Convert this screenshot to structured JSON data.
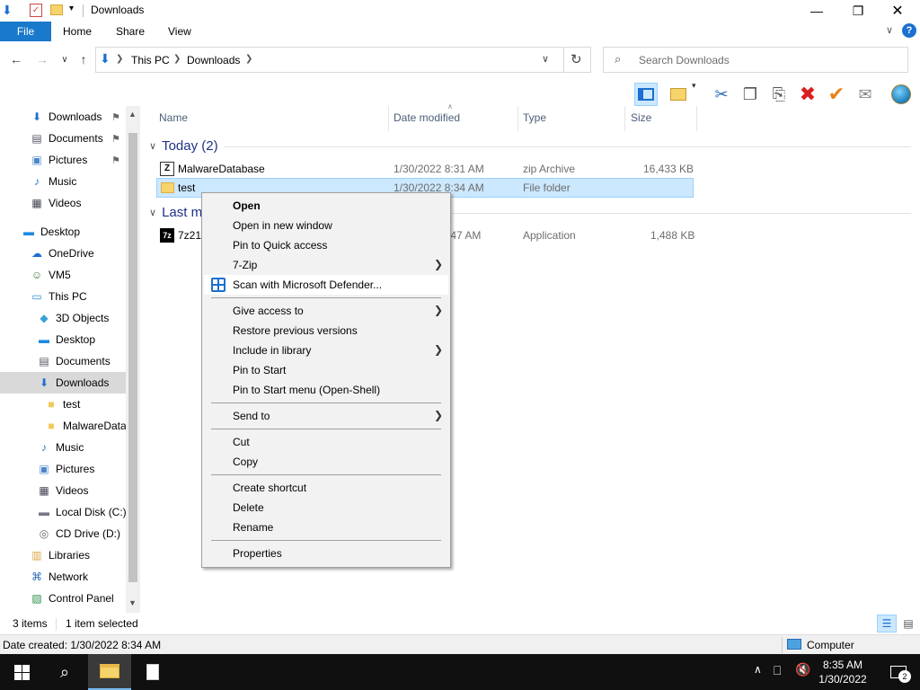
{
  "window": {
    "title": "Downloads"
  },
  "ribbon": {
    "tabs": [
      "File",
      "Home",
      "Share",
      "View"
    ],
    "help": "?"
  },
  "address": {
    "crumbs": [
      "This PC",
      "Downloads"
    ],
    "search_placeholder": "Search Downloads"
  },
  "nav": {
    "items": [
      {
        "label": "Downloads",
        "icon": "download-arrow-icon",
        "pinned": true
      },
      {
        "label": "Documents",
        "icon": "documents-icon",
        "pinned": true
      },
      {
        "label": "Pictures",
        "icon": "pictures-icon",
        "pinned": true
      },
      {
        "label": "Music",
        "icon": "music-icon"
      },
      {
        "label": "Videos",
        "icon": "videos-icon"
      },
      {
        "label": "Desktop",
        "icon": "desktop-icon"
      },
      {
        "label": "OneDrive",
        "icon": "cloud-icon"
      },
      {
        "label": "VM5",
        "icon": "user-icon"
      },
      {
        "label": "This PC",
        "icon": "computer-icon"
      },
      {
        "label": "3D Objects",
        "icon": "cube-icon"
      },
      {
        "label": "Desktop",
        "icon": "desktop-icon"
      },
      {
        "label": "Documents",
        "icon": "documents-icon"
      },
      {
        "label": "Downloads",
        "icon": "download-arrow-icon",
        "selected": true
      },
      {
        "label": "test",
        "icon": "folder-icon"
      },
      {
        "label": "MalwareData",
        "icon": "folder-icon"
      },
      {
        "label": "Music",
        "icon": "music-icon"
      },
      {
        "label": "Pictures",
        "icon": "pictures-icon"
      },
      {
        "label": "Videos",
        "icon": "videos-icon"
      },
      {
        "label": "Local Disk (C:)",
        "icon": "drive-icon"
      },
      {
        "label": "CD Drive (D:)",
        "icon": "cd-drive-icon"
      },
      {
        "label": "Libraries",
        "icon": "libraries-icon"
      },
      {
        "label": "Network",
        "icon": "network-icon"
      },
      {
        "label": "Control Panel",
        "icon": "control-panel-icon"
      }
    ]
  },
  "columns": [
    "Name",
    "Date modified",
    "Type",
    "Size"
  ],
  "groups": [
    {
      "label": "Today (2)",
      "rows": [
        {
          "name": "MalwareDatabase",
          "date": "1/30/2022 8:31 AM",
          "type": "zip Archive",
          "size": "16,433 KB",
          "icon": "zip-icon"
        },
        {
          "name": "test",
          "date": "1/30/2022 8:34 AM",
          "type": "File folder",
          "size": "",
          "icon": "folder-icon",
          "selected": true
        }
      ]
    },
    {
      "label": "Last m",
      "rows": [
        {
          "name": "7z21",
          "date": ":47 AM",
          "type": "Application",
          "size": "1,488 KB",
          "icon": "7zip-icon"
        }
      ]
    }
  ],
  "context_menu": {
    "items": [
      {
        "label": "Open",
        "bold": true
      },
      {
        "label": "Open in new window"
      },
      {
        "label": "Pin to Quick access"
      },
      {
        "label": "7-Zip",
        "submenu": true
      },
      {
        "label": "Scan with Microsoft Defender...",
        "icon": "defender-icon",
        "highlight": true
      },
      {
        "sep": true
      },
      {
        "label": "Give access to",
        "submenu": true
      },
      {
        "label": "Restore previous versions"
      },
      {
        "label": "Include in library",
        "submenu": true
      },
      {
        "label": "Pin to Start"
      },
      {
        "label": "Pin to Start menu (Open-Shell)"
      },
      {
        "sep": true
      },
      {
        "label": "Send to",
        "submenu": true
      },
      {
        "sep": true
      },
      {
        "label": "Cut"
      },
      {
        "label": "Copy"
      },
      {
        "sep": true
      },
      {
        "label": "Create shortcut"
      },
      {
        "label": "Delete"
      },
      {
        "label": "Rename"
      },
      {
        "sep": true
      },
      {
        "label": "Properties"
      }
    ]
  },
  "status": {
    "items": "3 items",
    "selected": "1 item selected"
  },
  "details": {
    "created": "Date created: 1/30/2022 8:34 AM",
    "location": "Computer"
  },
  "taskbar": {
    "time": "8:35 AM",
    "date": "1/30/2022",
    "notifications": "2"
  }
}
